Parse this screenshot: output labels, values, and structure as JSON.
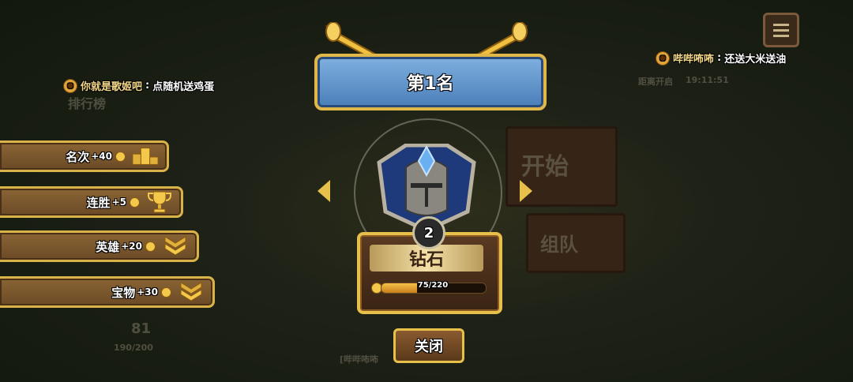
{
  "chat": {
    "left": {
      "user": "你就是歌姬吧",
      "message": "点随机送鸡蛋"
    },
    "right": {
      "user": "哔哔咘咘",
      "message": "还送大米送油"
    }
  },
  "background": {
    "start_sign": "开始",
    "team_sign": "组队",
    "leaderboard_sign": "排行榜",
    "event_timer_label": "距离开启",
    "event_timer_value": "19:11:51",
    "level_number": "81",
    "xp_text": "190/200",
    "chat_ticker": "[哔哔咘咘"
  },
  "rewards": [
    {
      "label": "名次",
      "amount": "+40",
      "icon": "podium-icon"
    },
    {
      "label": "连胜",
      "amount": "+5",
      "icon": "trophy-icon"
    },
    {
      "label": "英雄",
      "amount": "+20",
      "icon": "chevron-rank-icon"
    },
    {
      "label": "宝物",
      "amount": "+30",
      "icon": "chevron-rank-icon"
    }
  ],
  "banner": {
    "title": "第1名"
  },
  "rank": {
    "tier_number": "2",
    "tier_name": "钻石",
    "progress_text": "75/220",
    "progress_current": 75,
    "progress_max": 220
  },
  "buttons": {
    "close": "关闭"
  },
  "colors": {
    "gold": "#e6c04a",
    "banner_blue": "#4a7eb8",
    "wood": "#6a4a26"
  }
}
